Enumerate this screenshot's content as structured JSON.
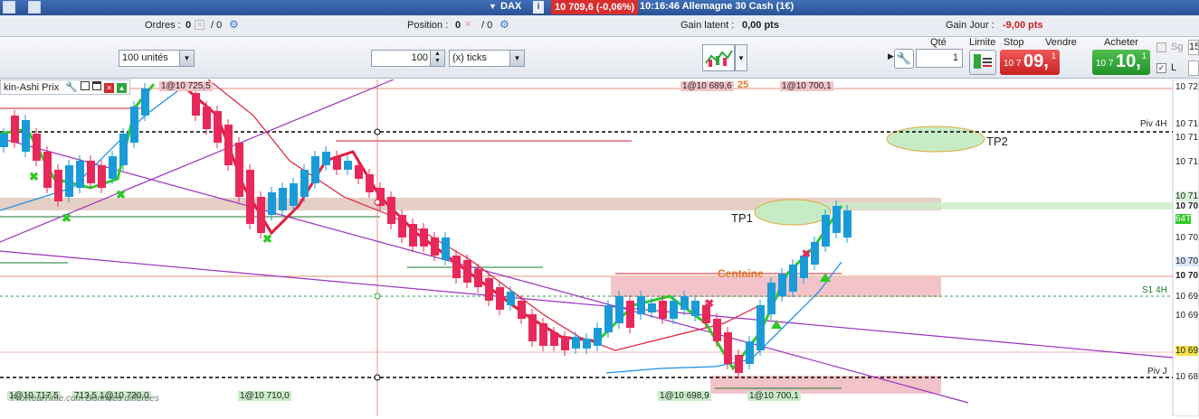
{
  "titlebar": {
    "instrument_short": "DAX",
    "price_badge": "10 709,6 (-0,06%)",
    "time_title": "10:16:46 Allemagne 30 Cash (1€)"
  },
  "status": {
    "orders_label": "Ordres :",
    "orders_value": "0",
    "orders_pending": "/ 0",
    "position_label": "Position :",
    "position_value": "0",
    "position_pending": "/ 0",
    "gain_latent_label": "Gain latent :",
    "gain_latent_value": "0,00 pts",
    "gain_jour_label": "Gain Jour :",
    "gain_jour_value": "-9,00 pts",
    "gain_jour_color": "#d01f1f"
  },
  "toolbar": {
    "units_select": "100 unités",
    "quantity_value": "100",
    "tick_select": "(x) ticks"
  },
  "order_panel": {
    "qte_label": "Qté",
    "qte_value": "1",
    "limite_label": "Limite",
    "stop_label": "Stop",
    "vendre_label": "Vendre",
    "acheter_label": "Acheter",
    "sell_prefix": "10 7",
    "sell_big": "09,",
    "sell_sup": "1",
    "buy_prefix": "10 7",
    "buy_big": "10,",
    "buy_sup": "1",
    "sg_label": "Sg",
    "sg_value": "15",
    "l_label": "L"
  },
  "chart": {
    "indicator_title": "kin-Ashi Prix",
    "annotations": {
      "tp1": "TP1",
      "tp2": "TP2",
      "centaine": "Centaine",
      "piv4h": "Piv 4H",
      "s14h": "S1 4H",
      "pivj": "Piv J",
      "tag_25": "25",
      "watermark": "ProRealTime.com Données différées"
    },
    "order_tags_top": [
      "1@10 725,5",
      "1@10 689,6",
      "1@10 700,1"
    ],
    "order_tags_bottom": [
      "1@10 717,5",
      "713,5",
      "1@10 720,0",
      "1@10 710,0",
      "1@10 698,9",
      "1@10 700,1"
    ],
    "right_axis": [
      "10 72",
      "10 71",
      "10 71",
      "10 71",
      "10 71",
      "10 70",
      "64T",
      "10 70",
      "10 70",
      "10 70",
      "10 69",
      "10 69",
      "10 69",
      "10 68"
    ],
    "colors": {
      "bull": "#1a9bd7",
      "bear": "#e8285a",
      "ma_green": "#2fc928",
      "ma_red": "#e01e3c",
      "ma_blue": "#1e90e8",
      "trend_purple": "#9b30c0",
      "level_black": "#000000",
      "zone_pink": "#f2c3c9",
      "zone_green": "#bfe8bf"
    }
  }
}
